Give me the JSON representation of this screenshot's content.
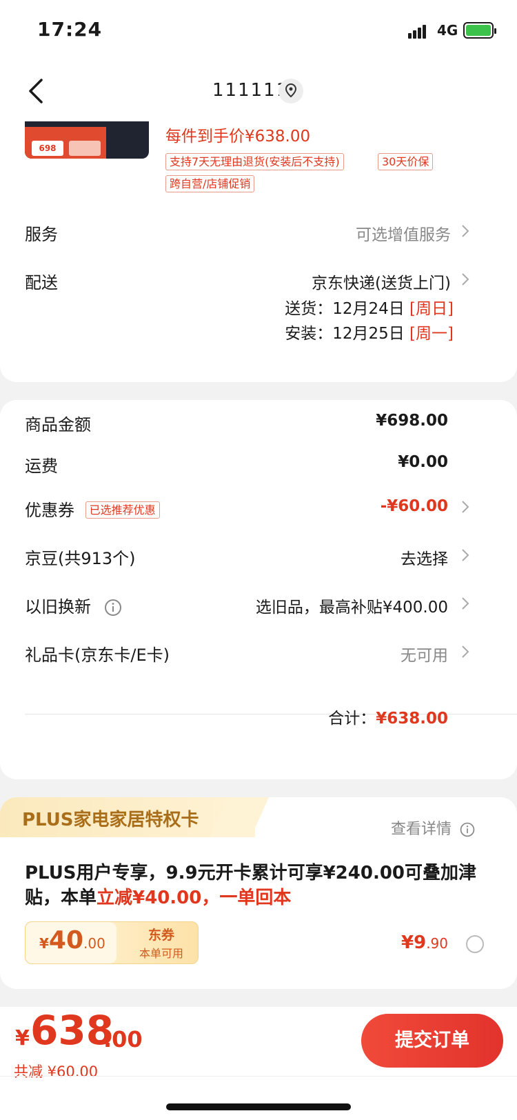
{
  "status_bar": {
    "time": "17:24",
    "network": "4G"
  },
  "nav": {
    "title": "111111"
  },
  "product": {
    "thumb_text": "698",
    "unit_price": "每件到手价¥638.00",
    "tags": [
      "支持7天无理由退货(安装后不支持)",
      "30天价保",
      "跨自营/店铺促销"
    ]
  },
  "service": {
    "label": "服务",
    "value": "可选增值服务"
  },
  "delivery": {
    "label": "配送",
    "value": "京东快递(送货上门)",
    "ship_label": "送货：",
    "ship_date": "12月24日",
    "ship_day": "[周日]",
    "install_label": "安装：",
    "install_date": "12月25日",
    "install_day": "[周一]"
  },
  "amounts": {
    "goods_label": "商品金额",
    "goods_value": "¥698.00",
    "shipping_label": "运费",
    "shipping_value": "¥0.00",
    "coupon_label": "优惠券",
    "coupon_tag": "已选推荐优惠",
    "coupon_value": "-¥60.00",
    "beans_label": "京豆(共913个)",
    "beans_value": "去选择",
    "tradein_label": "以旧换新",
    "tradein_value": "选旧品，最高补贴¥400.00",
    "giftcard_label": "礼品卡(京东卡/E卡)",
    "giftcard_value": "无可用",
    "total_label": "合计：",
    "total_value": "¥638.00"
  },
  "plus": {
    "title": "PLUS家电家居特权卡",
    "detail": "查看详情",
    "desc_black": "PLUS用户专享，9.9元开卡累计可享¥240.00可叠加津贴，本单",
    "desc_red": "立减¥40.00，一单回本",
    "coupon_yen": "¥",
    "coupon_int": "40",
    "coupon_dec": ".00",
    "coupon_title": "东券",
    "coupon_sub": "本单可用",
    "price_int": "¥9",
    "price_dec": ".90"
  },
  "footer": {
    "yen": "¥",
    "total_int": "638",
    "total_dec": ".00",
    "saved": "共减 ¥60.00",
    "submit": "提交订单"
  },
  "colors": {
    "accent": "#e0381e",
    "plus_gold": "#a96e1a",
    "battery": "#3bc24a"
  }
}
